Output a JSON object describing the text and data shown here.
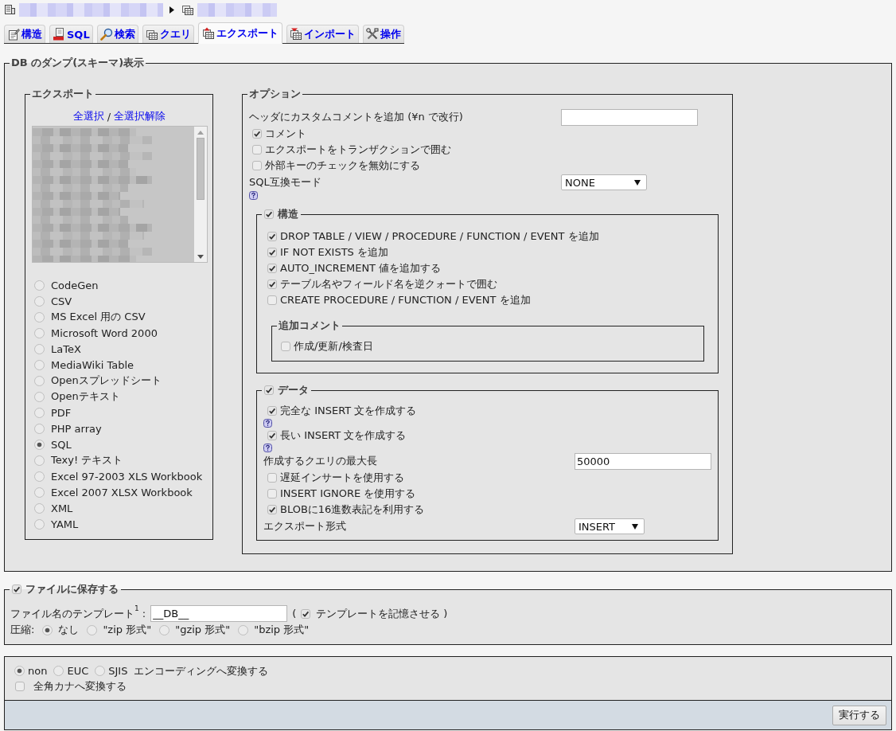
{
  "tabs": [
    {
      "kind": "structure",
      "label": "構造",
      "selected": false
    },
    {
      "kind": "sql",
      "label": "SQL",
      "selected": false
    },
    {
      "kind": "search",
      "label": "検索",
      "selected": false
    },
    {
      "kind": "query",
      "label": "クエリ",
      "selected": false
    },
    {
      "kind": "export",
      "label": "エクスポート",
      "selected": true
    },
    {
      "kind": "import",
      "label": "インポート",
      "selected": false
    },
    {
      "kind": "operations",
      "label": "操作",
      "selected": false
    }
  ],
  "dump": {
    "legend": "DB のダンプ(スキーマ)表示",
    "export": {
      "legend": "エクスポート",
      "select_all": "全選択",
      "separator": "/",
      "deselect_all": "全選択解除",
      "formats": [
        {
          "label": "CodeGen",
          "selected": false
        },
        {
          "label": "CSV",
          "selected": false
        },
        {
          "label": "MS Excel 用の CSV",
          "selected": false
        },
        {
          "label": "Microsoft Word 2000",
          "selected": false
        },
        {
          "label": "LaTeX",
          "selected": false
        },
        {
          "label": "MediaWiki Table",
          "selected": false
        },
        {
          "label": "Openスプレッドシート",
          "selected": false
        },
        {
          "label": "Openテキスト",
          "selected": false
        },
        {
          "label": "PDF",
          "selected": false
        },
        {
          "label": "PHP array",
          "selected": false
        },
        {
          "label": "SQL",
          "selected": true
        },
        {
          "label": "Texy! テキスト",
          "selected": false
        },
        {
          "label": "Excel 97-2003 XLS Workbook",
          "selected": false
        },
        {
          "label": "Excel 2007 XLSX Workbook",
          "selected": false
        },
        {
          "label": "XML",
          "selected": false
        },
        {
          "label": "YAML",
          "selected": false
        }
      ]
    },
    "options": {
      "legend": "オプション",
      "header_comment": {
        "label": "ヘッダにカスタムコメントを追加 (¥n で改行)"
      },
      "checks": [
        {
          "label": "コメント",
          "checked": true
        },
        {
          "label": "エクスポートをトランザクションで囲む",
          "checked": false
        },
        {
          "label": "外部キーのチェックを無効にする",
          "checked": false
        }
      ],
      "compatibility": {
        "label": "SQL互換モード",
        "value": "NONE",
        "help": true
      },
      "structure": {
        "legend": "構造",
        "checked": true,
        "items": [
          {
            "label": "DROP TABLE / VIEW / PROCEDURE / FUNCTION / EVENT を追加",
            "checked": true
          },
          {
            "label": "IF NOT EXISTS を追加",
            "checked": true
          },
          {
            "label": "AUTO_INCREMENT 値を追加する",
            "checked": true
          },
          {
            "label": "テーブル名やフィールド名を逆クォートで囲む",
            "checked": true
          },
          {
            "label": "CREATE PROCEDURE / FUNCTION / EVENT を追加",
            "checked": false
          }
        ],
        "comments": {
          "legend": "追加コメント",
          "items": [
            {
              "label": "作成/更新/検査日",
              "checked": false
            }
          ]
        }
      },
      "data": {
        "legend": "データ",
        "checked": true,
        "items": [
          {
            "kind": "checkbox",
            "label": "完全な INSERT 文を作成する",
            "checked": true,
            "help": true
          },
          {
            "kind": "checkbox",
            "label": "長い INSERT 文を作成する",
            "checked": true,
            "help": true
          },
          {
            "kind": "field",
            "label": "作成するクエリの最大長",
            "value": "50000"
          },
          {
            "kind": "checkbox",
            "label": "遅延インサートを使用する",
            "checked": false,
            "help": false
          },
          {
            "kind": "checkbox",
            "label": "INSERT IGNORE を使用する",
            "checked": false,
            "help": false
          },
          {
            "kind": "checkbox",
            "label": "BLOBに16進数表記を利用する",
            "checked": true,
            "help": false
          },
          {
            "kind": "select",
            "label": "エクスポート形式",
            "value": "INSERT"
          }
        ]
      }
    }
  },
  "save_file": {
    "legend": "ファイルに保存する",
    "checked": true,
    "template_label": "ファイル名のテンプレート$^{1}$ :",
    "template_value": "__DB__",
    "open_paren": "(",
    "remember": {
      "label": "テンプレートを記憶させる",
      "checked": true
    },
    "close_paren": ")",
    "compression_label": "圧縮:",
    "compression": [
      {
        "label": "なし",
        "selected": true
      },
      {
        "label": "\"zip 形式\"",
        "selected": false
      },
      {
        "label": "\"gzip 形式\"",
        "selected": false
      },
      {
        "label": "\"bzip 形式\"",
        "selected": false
      }
    ]
  },
  "encoding": {
    "options": [
      {
        "label": "non",
        "selected": true
      },
      {
        "label": "EUC",
        "selected": false
      },
      {
        "label": "SJIS",
        "selected": false
      }
    ],
    "label": "エンコーディングへ変換する",
    "kana": {
      "label": "全角カナへ変換する",
      "checked": false
    }
  },
  "submit": "実行する"
}
